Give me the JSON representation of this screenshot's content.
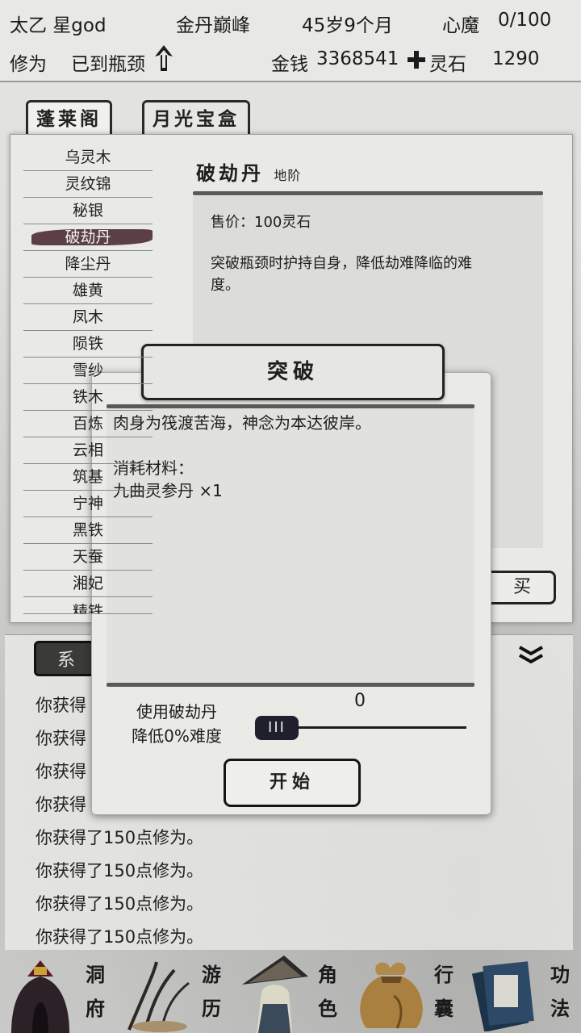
{
  "status": {
    "name": "太乙 星god",
    "realm": "金丹巅峰",
    "age": "45岁9个月",
    "heart_demon_label": "心魔",
    "heart_demon_value": "0/100",
    "cultivation_label": "修为",
    "cultivation_value": "已到瓶颈",
    "money_label": "金钱",
    "money_value": "3368541",
    "spirit_stone_label": "灵石",
    "spirit_stone_value": "1290"
  },
  "tabs": [
    "蓬莱阁",
    "月光宝盒"
  ],
  "shop": {
    "items": [
      "乌灵木",
      "灵纹锦",
      "秘银",
      "破劫丹",
      "降尘丹",
      "雄黄",
      "凤木",
      "陨铁",
      "雪纱",
      "铁木",
      "百炼",
      "云相",
      "筑基",
      "宁神",
      "黑铁",
      "天蚕",
      "湘妃",
      "精铁"
    ],
    "selected_index": 3,
    "detail": {
      "name": "破劫丹",
      "grade": "地阶",
      "price": "售价：100灵石",
      "desc_line1": "突破瓶颈时护持自身，降低劫难降临的难",
      "desc_line2": "度。"
    },
    "buy_label": "买"
  },
  "log": {
    "tab_label": "系",
    "lines": [
      "你获得",
      "你获得",
      "你获得",
      "你获得",
      "你获得了150点修为。",
      "你获得了150点修为。",
      "你获得了150点修为。",
      "你获得了150点修为。"
    ]
  },
  "dialog": {
    "title": "突破",
    "text_line1": "肉身为筏渡苦海，神念为本达彼岸。",
    "materials_label": "消耗材料：",
    "material_item": "九曲灵参丹  ×1",
    "use_label_line1": "使用破劫丹",
    "use_label_line2": "降低0%难度",
    "slider_value": "0",
    "slider_thumb_label": "III",
    "start_label": "开始"
  },
  "nav": [
    {
      "line1": "洞",
      "line2": "府",
      "icon": "cave-icon"
    },
    {
      "line1": "游",
      "line2": "历",
      "icon": "travel-icon"
    },
    {
      "line1": "角",
      "line2": "色",
      "icon": "character-icon"
    },
    {
      "line1": "行",
      "line2": "囊",
      "icon": "bag-icon"
    },
    {
      "line1": "功",
      "line2": "法",
      "icon": "scroll-icon"
    }
  ]
}
